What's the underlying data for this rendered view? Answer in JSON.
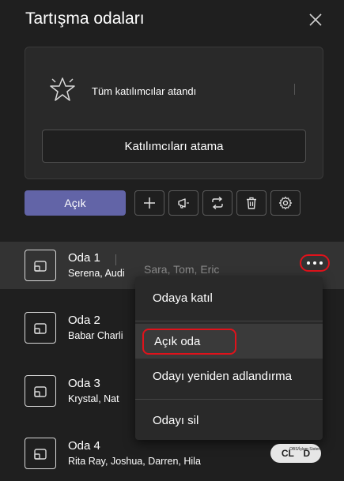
{
  "header": {
    "title": "Tartışma odaları",
    "close_icon": "close-icon"
  },
  "assignment_card": {
    "status_text": "Tüm katılımcılar atandı",
    "status_icon": "star-icon",
    "assign_button_label": "Katılımcıları atama"
  },
  "toolbar": {
    "open_button_label": "Açık",
    "tools": [
      "add-icon",
      "announce-icon",
      "reassign-icon",
      "delete-icon",
      "settings-icon"
    ]
  },
  "rooms": [
    {
      "name": "Oda 1",
      "members": "Serena, Audi",
      "members_overflow": "Sara, Tom, Eric"
    },
    {
      "name": "Oda 2",
      "members": "Babar Charli"
    },
    {
      "name": "Oda 3",
      "members": "Krystal, Nat"
    },
    {
      "name": "Oda 4",
      "members": "Rita Ray, Joshua, Darren, Hila"
    }
  ],
  "context_menu": {
    "join": "Odaya katıl",
    "open": "Açık oda",
    "rename": "Odayı yeniden adlandırma",
    "delete": "Odayı sil"
  },
  "badge": {
    "left": "CL",
    "right": "D",
    "note": "OBS/İşlem Sistemi"
  },
  "colors": {
    "background": "#1f1f1f",
    "accent": "#6264a7",
    "highlight": "#e0121b"
  }
}
